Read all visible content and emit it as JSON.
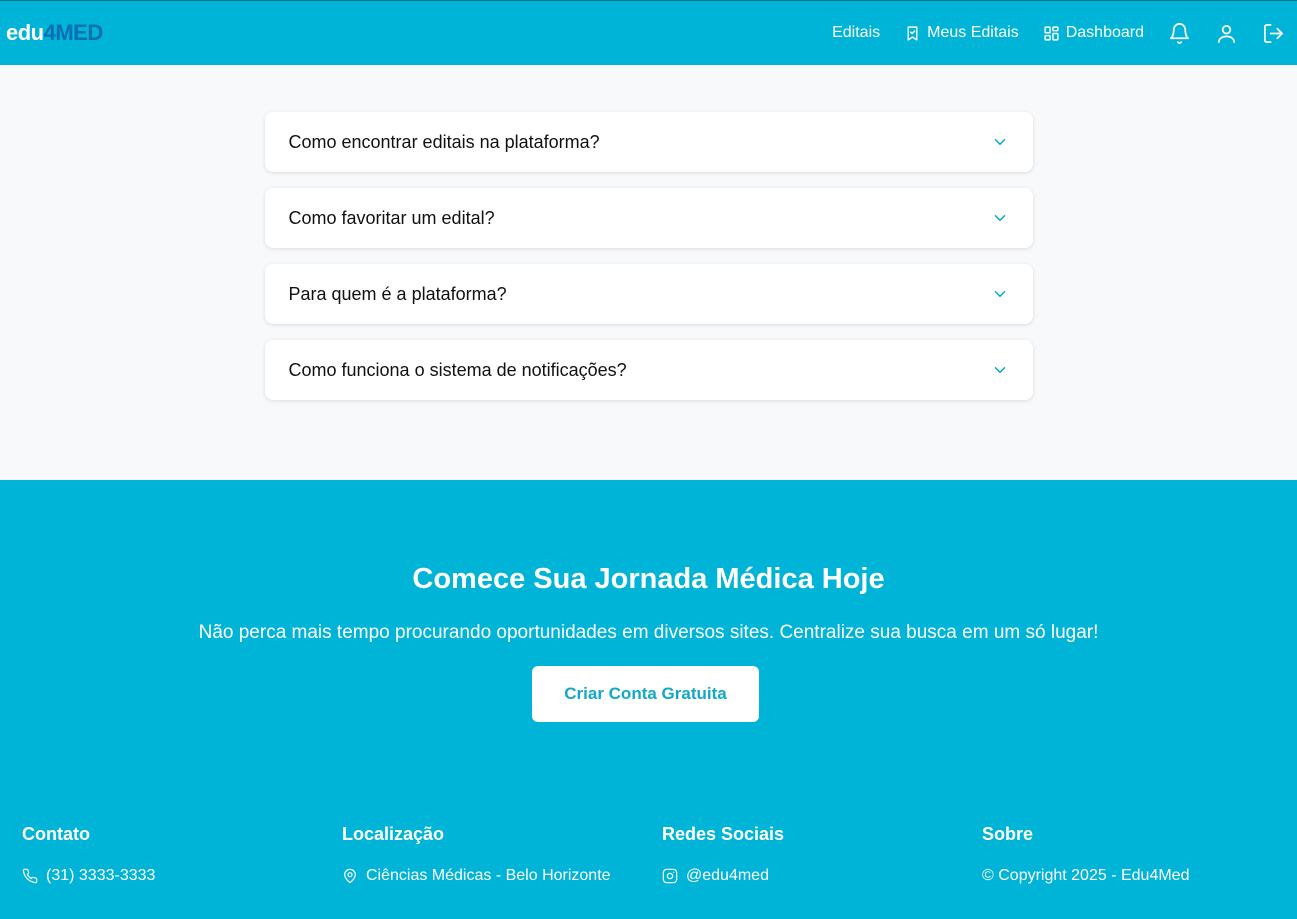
{
  "brand": {
    "part1": "edu",
    "part2": "4MED"
  },
  "nav": {
    "editais": "Editais",
    "meus_editais": "Meus Editais",
    "dashboard": "Dashboard"
  },
  "faq": [
    {
      "question": "Como encontrar editais na plataforma?"
    },
    {
      "question": "Como favoritar um edital?"
    },
    {
      "question": "Para quem é a plataforma?"
    },
    {
      "question": "Como funciona o sistema de notificações?"
    }
  ],
  "cta": {
    "title": "Comece Sua Jornada Médica Hoje",
    "subtitle": "Não perca mais tempo procurando oportunidades em diversos sites. Centralize sua busca em um só lugar!",
    "button": "Criar Conta Gratuita"
  },
  "footer": {
    "contato": {
      "title": "Contato",
      "value": "(31) 3333-3333"
    },
    "localizacao": {
      "title": "Localização",
      "value": "Ciências Médicas - Belo Horizonte"
    },
    "redes": {
      "title": "Redes Sociais",
      "value": "@edu4med"
    },
    "sobre": {
      "title": "Sobre",
      "value": "© Copyright 2025 - Edu4Med"
    }
  },
  "colors": {
    "primary": "#00b4d8",
    "logo_accent": "#0a6fb0",
    "chevron": "#00a7cc",
    "page_bg": "#f8f9fb"
  },
  "icons": [
    "bookmark-icon",
    "grid-icon",
    "bell-icon",
    "user-icon",
    "logout-icon",
    "chevron-down-icon",
    "phone-icon",
    "map-pin-icon",
    "instagram-icon"
  ]
}
